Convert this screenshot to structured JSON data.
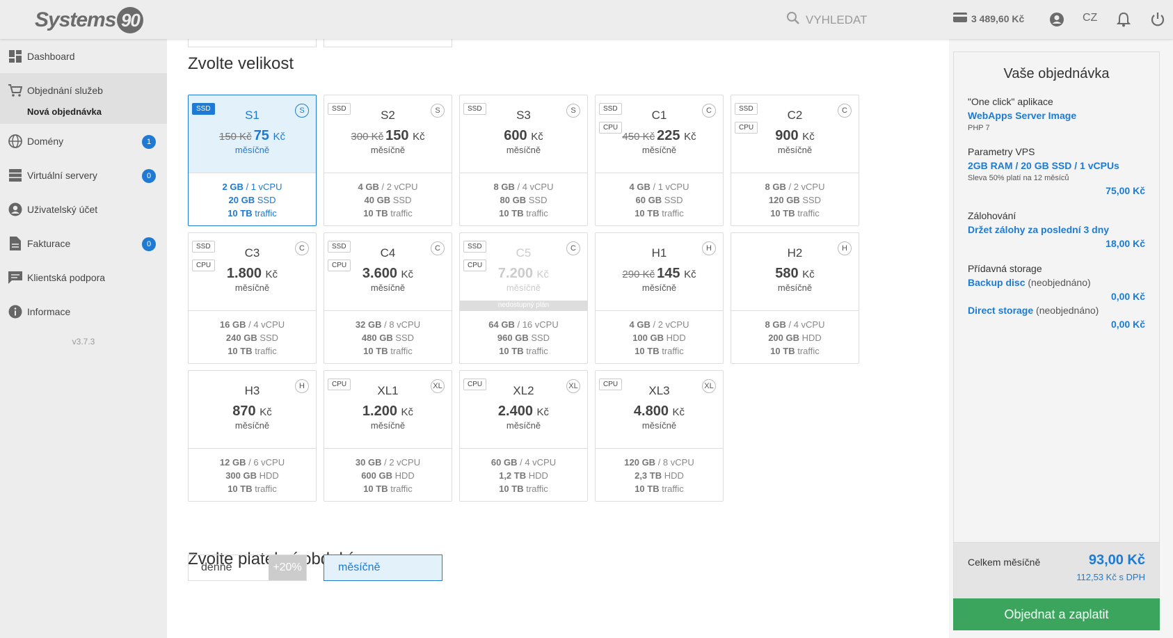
{
  "header": {
    "logo_text": "Systems",
    "logo_number": "90",
    "search_placeholder": "VYHLEDAT",
    "credit": "3 489,60 Kč",
    "lang": "CZ"
  },
  "sidebar": {
    "items": [
      {
        "label": "Dashboard",
        "icon": "dashboard-icon"
      },
      {
        "label": "Objednání služeb",
        "icon": "cart-icon"
      },
      {
        "label": "Domény",
        "icon": "globe-icon",
        "badge": "1"
      },
      {
        "label": "Virtuální servery",
        "icon": "server-icon",
        "badge": "0"
      },
      {
        "label": "Uživatelský účet",
        "icon": "user-icon"
      },
      {
        "label": "Fakturace",
        "icon": "document-icon",
        "badge": "0"
      },
      {
        "label": "Klientská podpora",
        "icon": "chat-icon"
      },
      {
        "label": "Informace",
        "icon": "info-icon"
      }
    ],
    "sub_item": "Nová objednávka",
    "version": "v3.7.3"
  },
  "main": {
    "size_title": "Zvolte velikost",
    "period_title": "Zvolte platební období",
    "period_daily": "denně",
    "period_daily_pct": "+20%",
    "period_monthly": "měsíčně",
    "unavailable_label": "nedostupný plán",
    "currency": "Kč",
    "plans": [
      {
        "name": "S1",
        "letter": "S",
        "ssd": true,
        "cpu": false,
        "old": "150 Kč",
        "price": "75",
        "per": "měsíčně",
        "ram": "2 GB",
        "vcpu": "/ 1 vCPU",
        "disk": "20 GB",
        "disk_type": "SSD",
        "traffic": "10 TB",
        "traffic_label": "traffic",
        "selected": true
      },
      {
        "name": "S2",
        "letter": "S",
        "ssd": true,
        "cpu": false,
        "old": "300 Kč",
        "price": "150",
        "per": "měsíčně",
        "ram": "4 GB",
        "vcpu": "/ 2 vCPU",
        "disk": "40 GB",
        "disk_type": "SSD",
        "traffic": "10 TB",
        "traffic_label": "traffic"
      },
      {
        "name": "S3",
        "letter": "S",
        "ssd": true,
        "cpu": false,
        "old": "",
        "price": "600",
        "per": "měsíčně",
        "ram": "8 GB",
        "vcpu": "/ 4 vCPU",
        "disk": "80 GB",
        "disk_type": "SSD",
        "traffic": "10 TB",
        "traffic_label": "traffic"
      },
      {
        "name": "C1",
        "letter": "C",
        "ssd": true,
        "cpu": true,
        "old": "450 Kč",
        "price": "225",
        "per": "měsíčně",
        "ram": "4 GB",
        "vcpu": "/ 1 vCPU",
        "disk": "60 GB",
        "disk_type": "SSD",
        "traffic": "10 TB",
        "traffic_label": "traffic"
      },
      {
        "name": "C2",
        "letter": "C",
        "ssd": true,
        "cpu": true,
        "old": "",
        "price": "900",
        "per": "měsíčně",
        "ram": "8 GB",
        "vcpu": "/ 2 vCPU",
        "disk": "120 GB",
        "disk_type": "SSD",
        "traffic": "10 TB",
        "traffic_label": "traffic"
      },
      {
        "name": "C3",
        "letter": "C",
        "ssd": true,
        "cpu": true,
        "old": "",
        "price": "1.800",
        "per": "měsíčně",
        "ram": "16 GB",
        "vcpu": "/ 4 vCPU",
        "disk": "240 GB",
        "disk_type": "SSD",
        "traffic": "10 TB",
        "traffic_label": "traffic"
      },
      {
        "name": "C4",
        "letter": "C",
        "ssd": true,
        "cpu": true,
        "old": "",
        "price": "3.600",
        "per": "měsíčně",
        "ram": "32 GB",
        "vcpu": "/ 8 vCPU",
        "disk": "480 GB",
        "disk_type": "SSD",
        "traffic": "10 TB",
        "traffic_label": "traffic"
      },
      {
        "name": "C5",
        "letter": "C",
        "ssd": true,
        "cpu": true,
        "old": "",
        "price": "7.200",
        "per": "měsíčně",
        "ram": "64 GB",
        "vcpu": "/ 16 vCPU",
        "disk": "960 GB",
        "disk_type": "SSD",
        "traffic": "10 TB",
        "traffic_label": "traffic",
        "disabled": true
      },
      {
        "name": "H1",
        "letter": "H",
        "ssd": false,
        "cpu": false,
        "old": "290 Kč",
        "price": "145",
        "per": "měsíčně",
        "ram": "4 GB",
        "vcpu": "/ 2 vCPU",
        "disk": "100 GB",
        "disk_type": "HDD",
        "traffic": "10 TB",
        "traffic_label": "traffic"
      },
      {
        "name": "H2",
        "letter": "H",
        "ssd": false,
        "cpu": false,
        "old": "",
        "price": "580",
        "per": "měsíčně",
        "ram": "8 GB",
        "vcpu": "/ 4 vCPU",
        "disk": "200 GB",
        "disk_type": "HDD",
        "traffic": "10 TB",
        "traffic_label": "traffic"
      },
      {
        "name": "H3",
        "letter": "H",
        "ssd": false,
        "cpu": false,
        "old": "",
        "price": "870",
        "per": "měsíčně",
        "ram": "12 GB",
        "vcpu": "/ 6 vCPU",
        "disk": "300 GB",
        "disk_type": "HDD",
        "traffic": "10 TB",
        "traffic_label": "traffic"
      },
      {
        "name": "XL1",
        "letter": "XL",
        "ssd": false,
        "cpu": true,
        "old": "",
        "price": "1.200",
        "per": "měsíčně",
        "ram": "30 GB",
        "vcpu": "/ 2 vCPU",
        "disk": "600 GB",
        "disk_type": "HDD",
        "traffic": "10 TB",
        "traffic_label": "traffic"
      },
      {
        "name": "XL2",
        "letter": "XL",
        "ssd": false,
        "cpu": true,
        "old": "",
        "price": "2.400",
        "per": "měsíčně",
        "ram": "60 GB",
        "vcpu": "/ 4 vCPU",
        "disk": "1,2 TB",
        "disk_type": "HDD",
        "traffic": "10 TB",
        "traffic_label": "traffic"
      },
      {
        "name": "XL3",
        "letter": "XL",
        "ssd": false,
        "cpu": true,
        "old": "",
        "price": "4.800",
        "per": "měsíčně",
        "ram": "120 GB",
        "vcpu": "/ 8 vCPU",
        "disk": "2,3 TB",
        "disk_type": "HDD",
        "traffic": "10 TB",
        "traffic_label": "traffic"
      }
    ]
  },
  "order": {
    "title": "Vaše objednávka",
    "app_label": "\"One click\" aplikace",
    "app_value": "WebApps Server Image",
    "app_note": "PHP 7",
    "vps_label": "Parametry VPS",
    "vps_value": "2GB RAM / 20 GB SSD / 1 vCPUs",
    "vps_note": "Sleva 50% platí na 12 měsíců",
    "vps_price": "75,00 Kč",
    "backup_label": "Zálohování",
    "backup_value": "Držet zálohy za poslední 3 dny",
    "backup_price": "18,00 Kč",
    "storage_label": "Přídavná storage",
    "backup_disc": "Backup disc",
    "not_ordered": "(neobjednáno)",
    "backup_disc_price": "0,00 Kč",
    "direct_storage": "Direct storage",
    "direct_storage_price": "0,00 Kč",
    "total_label": "Celkem měsíčně",
    "total_value": "93,00 Kč",
    "total_vat": "112,53 Kč s DPH",
    "button": "Objednat a zaplatit"
  },
  "colors": {
    "accent": "#1e7ad2",
    "selected_bg": "#e3f1fb",
    "order_button": "#3ba55d"
  }
}
